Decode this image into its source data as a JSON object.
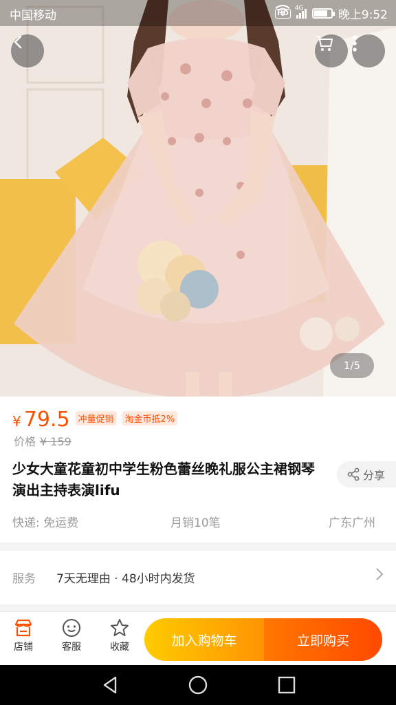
{
  "status_bar": {
    "carrier": "中国移动",
    "network": "4G",
    "time": "晚上9:52",
    "battery_level": 0.8
  },
  "hero": {
    "image_description_icon": "product-photo",
    "pager": "1/5"
  },
  "product": {
    "currency": "¥",
    "price": "79.5",
    "promo_tags": [
      "冲量促销",
      "淘金币抵2%"
    ],
    "original_price_label": "价格",
    "original_price": "¥ 159",
    "title": "少女大童花童初中学生粉色蕾丝晚礼服公主裙钢琴演出主持表演lifu",
    "share_label": "分享",
    "shipping": "快递: 免运费",
    "monthly_sales": "月销10笔",
    "location": "广东广州"
  },
  "service": {
    "label": "服务",
    "text": "7天无理由 · 48小时内发货"
  },
  "action_bar": {
    "shop_label": "店铺",
    "service_label": "客服",
    "favorite_label": "收藏",
    "add_to_cart_label": "加入购物车",
    "buy_now_label": "立即购买"
  },
  "colors": {
    "accent": "#ff5000",
    "cart_gradient": [
      "#ffcb00",
      "#ff9402"
    ],
    "buy_gradient": [
      "#ff7700",
      "#ff4900"
    ]
  }
}
